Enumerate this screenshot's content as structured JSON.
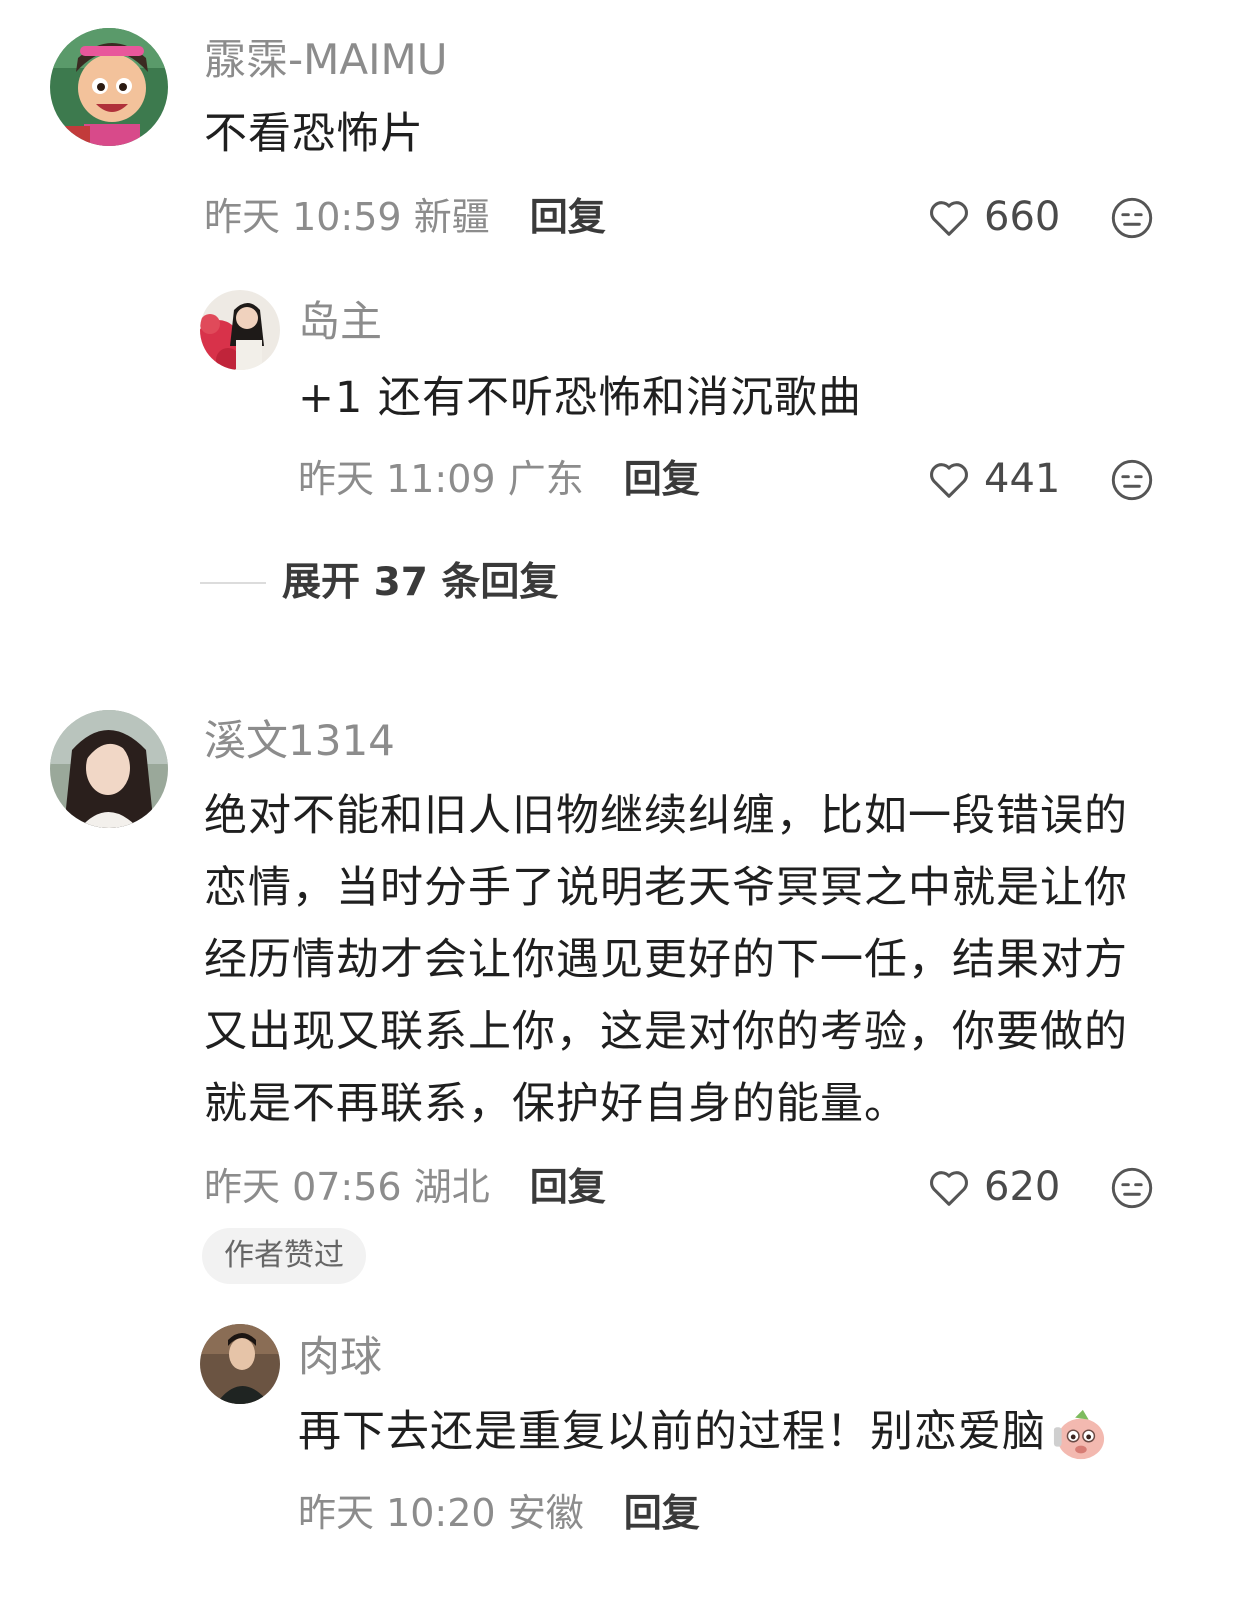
{
  "comments": [
    {
      "username": "霡霂-MAIMU",
      "content": "不看恐怖片",
      "time": "昨天 10:59",
      "location": "新疆",
      "reply_label": "回复",
      "likes": "660",
      "replies": [
        {
          "username": "岛主",
          "content": "+1 还有不听恐怖和消沉歌曲",
          "time": "昨天 11:09",
          "location": "广东",
          "reply_label": "回复",
          "likes": "441"
        }
      ],
      "expand_label": "展开 37 条回复"
    },
    {
      "username": "溪文1314",
      "content_lines": [
        "绝对不能和旧人旧物继续纠缠，比如一段错误的",
        "恋情，当时分手了说明老天爷冥冥之中就是让你",
        "经历情劫才会让你遇见更好的下一任，结果对方",
        "又出现又联系上你，这是对你的考验，你要做的",
        "就是不再联系，保护好自身的能量。"
      ],
      "time": "昨天 07:56",
      "location": "湖北",
      "reply_label": "回复",
      "likes": "620",
      "badge": "作者赞过",
      "replies": [
        {
          "username": "肉球",
          "content": "再下去还是重复以前的过程！别恋爱脑",
          "time": "昨天 10:20",
          "location": "安徽",
          "reply_label": "回复"
        }
      ]
    }
  ],
  "icons": {
    "like": "heart-outline-icon",
    "dislike": "meh-face-icon",
    "sticker": "pig-sticker-icon"
  },
  "colors": {
    "username": "#8c8c8c",
    "content": "#1f1f1f",
    "meta": "#8c8c8c",
    "reply": "#3a3a3a"
  }
}
